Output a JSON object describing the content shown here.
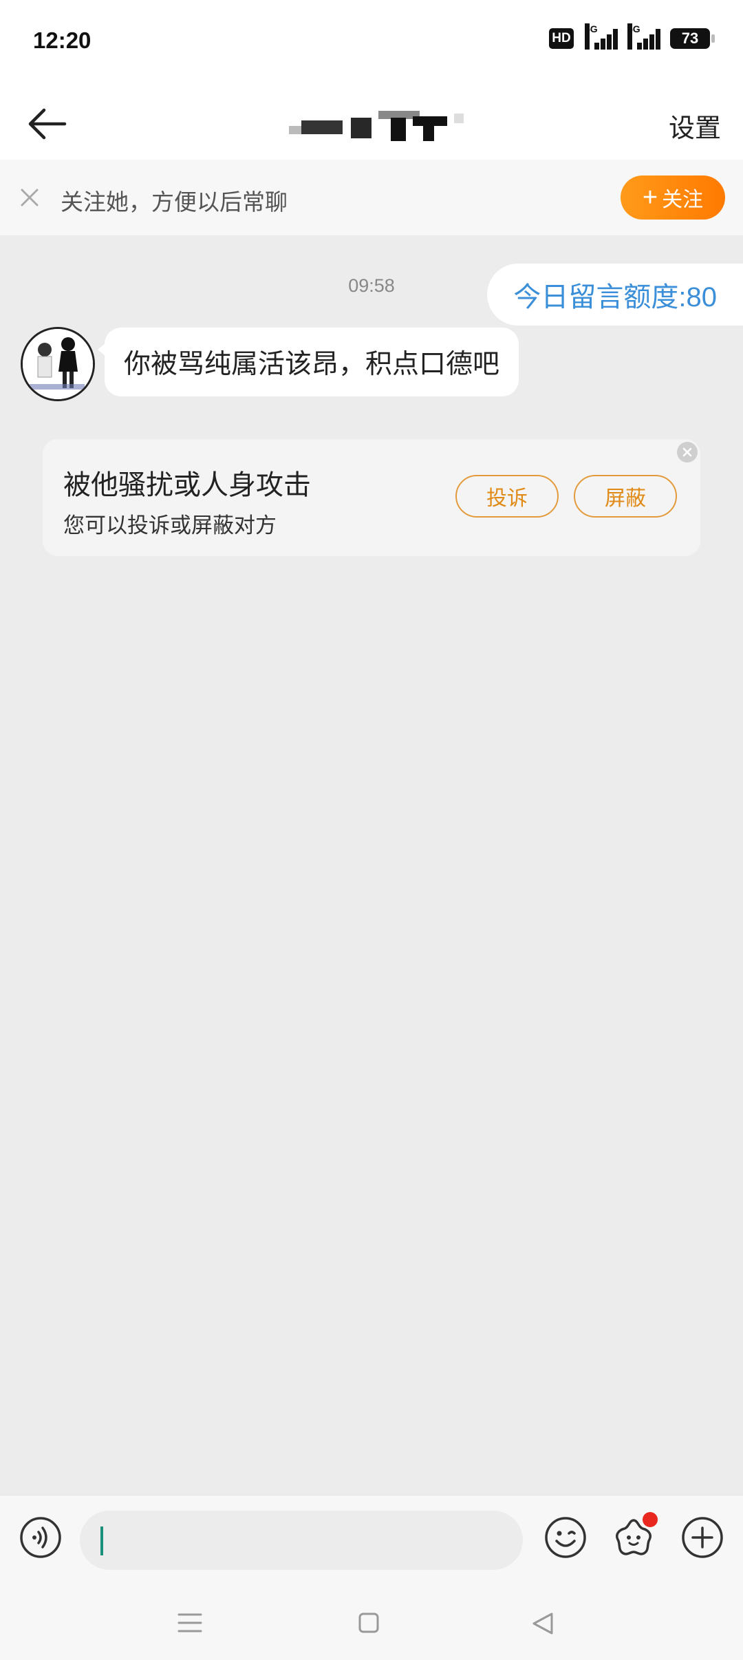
{
  "status_bar": {
    "time": "12:20",
    "hd_label": "HD",
    "signal_1": "5G",
    "signal_2": "5G",
    "battery": "73"
  },
  "header": {
    "back_icon": "back-arrow-icon",
    "title_redacted": true,
    "settings_label": "设置"
  },
  "follow_bar": {
    "text": "关注她，方便以后常聊",
    "button_label": "关注",
    "button_color": "#ff8a00"
  },
  "chat": {
    "timestamp": "09:58",
    "quota_text": "今日留言额度:80",
    "messages": [
      {
        "from": "other",
        "text": "你被骂纯属活该昂，积点口德吧"
      }
    ]
  },
  "harassment_card": {
    "title": "被他骚扰或人身攻击",
    "subtitle": "您可以投诉或屏蔽对方",
    "report_label": "投诉",
    "block_label": "屏蔽"
  },
  "input_bar": {
    "voice_icon": "voice-icon",
    "emoji_icon": "emoji-icon",
    "sticker_icon": "sticker-icon",
    "plus_icon": "plus-icon"
  },
  "colors": {
    "accent_orange": "#ff8a00",
    "quota_blue": "#3b8fd8",
    "chat_bg": "#ececec"
  }
}
